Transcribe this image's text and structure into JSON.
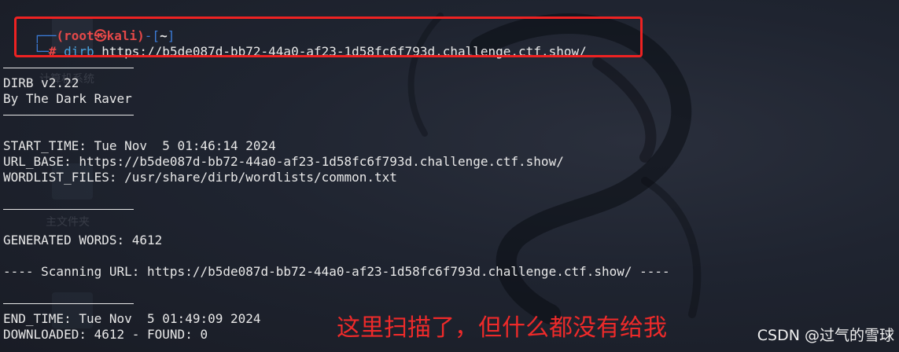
{
  "prompt": {
    "corner_top": "┌──",
    "user_host": "(root㉿kali)",
    "dash": "-",
    "dir": "[~]",
    "corner_bottom": "└─",
    "hash": "#",
    "command": "dirb",
    "argument": " https://b5de087d-bb72-44a0-af23-1d58fc6f793d.challenge.ctf.show/"
  },
  "output": {
    "banner_version": "DIRB v2.22",
    "banner_author": "By The Dark Raver",
    "start_time": "START_TIME: Tue Nov  5 01:46:14 2024",
    "url_base": "URL_BASE: https://b5de087d-bb72-44a0-af23-1d58fc6f793d.challenge.ctf.show/",
    "wordlist_files": "WORDLIST_FILES: /usr/share/dirb/wordlists/common.txt",
    "generated_words": "GENERATED WORDS: 4612",
    "scanning_url": "---- Scanning URL: https://b5de087d-bb72-44a0-af23-1d58fc6f793d.challenge.ctf.show/ ----",
    "end_time": "END_TIME: Tue Nov  5 01:49:09 2024",
    "downloaded": "DOWNLOADED: 4612 - FOUND: 0"
  },
  "background": {
    "desktop_label_1": "计算机系统",
    "desktop_label_2": "主文件夹"
  },
  "annotation": {
    "text": "这里扫描了，但什么都没有给我",
    "color": "#ee2a2a"
  },
  "watermark": {
    "text": "CSDN @过气的雪球"
  },
  "colors": {
    "prompt_blue": "#3b7bd6",
    "prompt_red": "#e54848",
    "command_blue": "#4aa3e0",
    "highlight_box": "#ee2222"
  }
}
